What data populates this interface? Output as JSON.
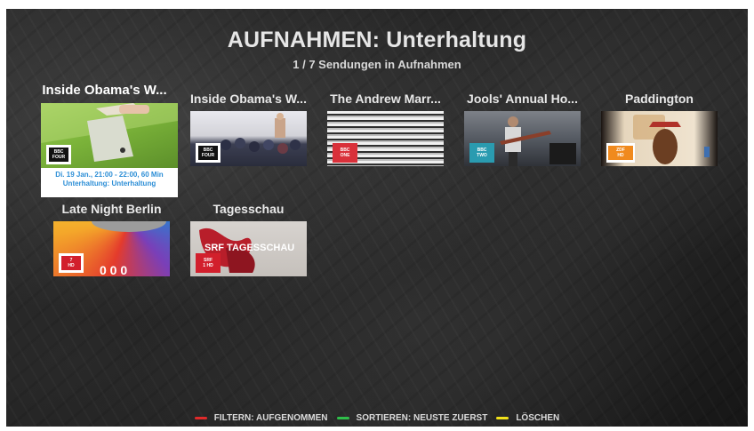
{
  "header": {
    "title": "AUFNAHMEN: Unterhaltung",
    "subtitle": "1 / 7 Sendungen in Aufnahmen"
  },
  "recordings": [
    {
      "label": "Inside Obama's W...",
      "channel": "BBC FOUR",
      "channel_lines": [
        "BBC",
        "FOUR"
      ],
      "focused": true,
      "meta_line1": "Di. 19 Jan., 21:00 - 22:00, 60 Min",
      "meta_line2": "Unterhaltung: Unterhaltung"
    },
    {
      "label": "Inside Obama's W...",
      "channel": "BBC FOUR",
      "channel_lines": [
        "BBC",
        "FOUR"
      ]
    },
    {
      "label": "The Andrew Marr...",
      "channel": "BBC ONE",
      "channel_lines": [
        "BBC",
        "ONE"
      ]
    },
    {
      "label": "Jools' Annual Ho...",
      "channel": "BBC TWO",
      "channel_lines": [
        "BBC",
        "TWO"
      ]
    },
    {
      "label": "Paddington",
      "channel": "ZDF HD",
      "channel_lines": [
        "ZDF",
        "HD"
      ]
    },
    {
      "label": "Late Night Berlin",
      "channel": "7 HD",
      "channel_lines": [
        "7",
        "HD"
      ]
    },
    {
      "label": "Tagesschau",
      "channel": "SRF 1 HD",
      "channel_lines": [
        "SRF",
        "1 HD"
      ],
      "overlay_text": "SRF TAGESSCHAU"
    }
  ],
  "footer": {
    "actions": [
      {
        "label": "FILTERN: AUFGENOMMEN",
        "color": "#e02a2a"
      },
      {
        "label": "SORTIEREN: NEUSTE ZUERST",
        "color": "#2fbf4a"
      },
      {
        "label": "LÖSCHEN",
        "color": "#f2e21a"
      }
    ]
  }
}
